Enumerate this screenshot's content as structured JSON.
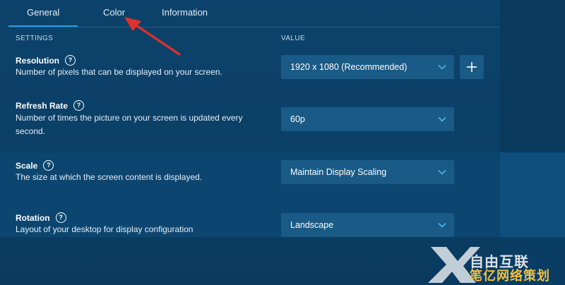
{
  "tabs": [
    {
      "label": "General",
      "active": true
    },
    {
      "label": "Color",
      "active": false
    },
    {
      "label": "Information",
      "active": false
    }
  ],
  "columns": {
    "settings": "SETTINGS",
    "value": "VALUE"
  },
  "rows": {
    "resolution": {
      "title": "Resolution",
      "desc": "Number of pixels that can be displayed on your screen.",
      "value": "1920 x 1080 (Recommended)"
    },
    "refresh": {
      "title": "Refresh Rate",
      "desc": "Number of times the picture on your screen is updated every second.",
      "value": "60p"
    },
    "scale": {
      "title": "Scale",
      "desc": "The size at which the screen content is displayed.",
      "value": "Maintain Display Scaling"
    },
    "rotation": {
      "title": "Rotation",
      "desc": "Layout of your desktop for display configuration",
      "value": "Landscape"
    }
  },
  "help_glyph": "?",
  "watermark": {
    "line1": "自由互联",
    "line2": "笔亿网络策划"
  },
  "colors": {
    "accent": "#2a9be0",
    "arrow": "#e0302a",
    "select_bg": "#195a86"
  }
}
